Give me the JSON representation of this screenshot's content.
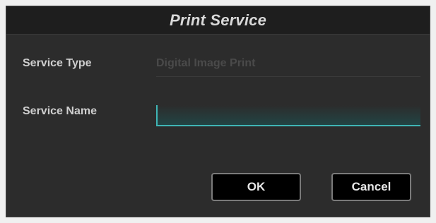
{
  "dialog": {
    "title": "Print Service"
  },
  "fields": {
    "service_type": {
      "label": "Service Type",
      "value": "Digital Image Print"
    },
    "service_name": {
      "label": "Service Name",
      "value": "",
      "placeholder": ""
    }
  },
  "buttons": {
    "ok_label": "OK",
    "cancel_label": "Cancel"
  },
  "colors": {
    "dialog_bg": "#2c2c2c",
    "titlebar_bg": "#1e1e1e",
    "accent": "#3fb5b5",
    "button_bg": "#000000"
  }
}
